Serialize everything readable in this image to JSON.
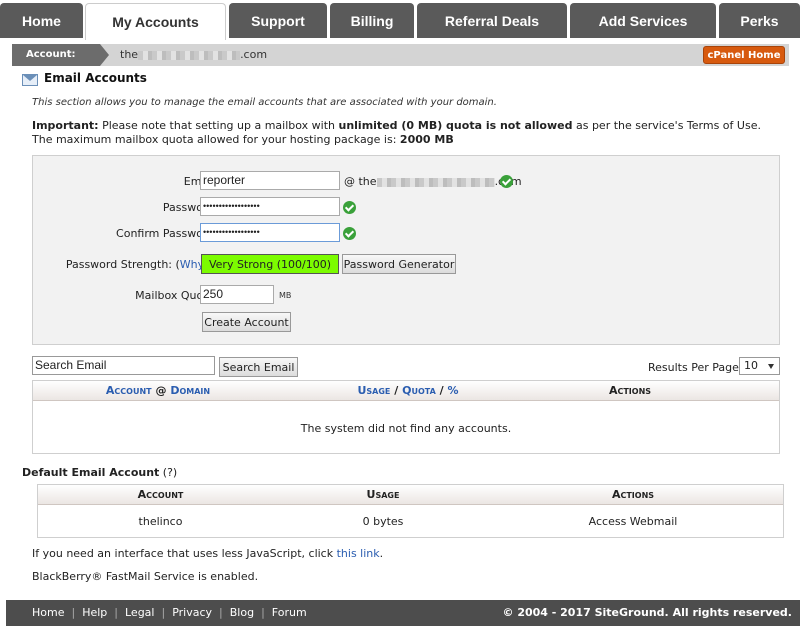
{
  "nav": {
    "tabs": [
      {
        "label": "Home"
      },
      {
        "label": "My Accounts"
      },
      {
        "label": "Support"
      },
      {
        "label": "Billing"
      },
      {
        "label": "Referral Deals"
      },
      {
        "label": "Add Services"
      },
      {
        "label": "Perks"
      }
    ]
  },
  "account_bar": {
    "label": "Account:",
    "domain_prefix": "the",
    "domain_suffix": ".com",
    "cpanel_button": "cPanel Home"
  },
  "section": {
    "title": "Email Accounts",
    "description": "This section allows you to manage the email accounts that are associated with your domain.",
    "important_label": "Important:",
    "important_text_1": " Please note that setting up a mailbox with ",
    "important_bold": "unlimited (0 MB) quota is not allowed",
    "important_text_2": " as per the service's Terms of Use. The maximum mailbox quota allowed for your hosting package is: ",
    "max_quota": "2000 MB"
  },
  "form": {
    "email_label": "Email:",
    "email_value": "reporter",
    "at_domain_prefix": "@ the",
    "at_domain_suffix": ".com",
    "password_label": "Password:",
    "password_value": "••••••••••••••••••",
    "confirm_label": "Confirm Password:",
    "confirm_value": "••••••••••••••••••",
    "strength_label": "Password Strength: (",
    "strength_why": "Why?",
    "strength_close": "):",
    "strength_value": "Very Strong (100/100)",
    "generator_button": "Password Generator",
    "quota_label": "Mailbox Quota:",
    "quota_value": "250",
    "quota_unit": "MB",
    "create_button": "Create Account"
  },
  "search": {
    "input_value": "Search Email",
    "button": "Search Email",
    "rpp_label": "Results Per Page:",
    "rpp_value": "10"
  },
  "accounts_table": {
    "col1_a": "Account",
    "col1_sep": " @ ",
    "col1_b": "Domain",
    "col2_a": "Usage",
    "col2_sep1": " / ",
    "col2_b": "Quota",
    "col2_sep2": " / ",
    "col2_c": "%",
    "col3": "Actions",
    "empty_message": "The system did not find any accounts."
  },
  "default_account": {
    "label": "Default Email Account",
    "help": " (?)",
    "headers": [
      "Account",
      "Usage",
      "Actions"
    ],
    "row": {
      "account": "thelinco",
      "usage": "0 bytes",
      "action": "Access Webmail"
    }
  },
  "notes": {
    "js_text": "If you need an interface that uses less JavaScript, click ",
    "js_link": "this link",
    "js_end": ".",
    "blackberry_link": "BlackBerry® FastMail Service is enabled."
  },
  "footer": {
    "links": [
      "Home",
      "Help",
      "Legal",
      "Privacy",
      "Blog",
      "Forum"
    ],
    "copyright": "© 2004 - 2017 SiteGround. All rights reserved."
  },
  "colors": {
    "tab_bg": "#5a5a5a",
    "accent_orange": "#d75a0f",
    "strength_green": "#7cfc00",
    "link_blue": "#2a5db0",
    "footer_bg": "#4d4d4d"
  }
}
